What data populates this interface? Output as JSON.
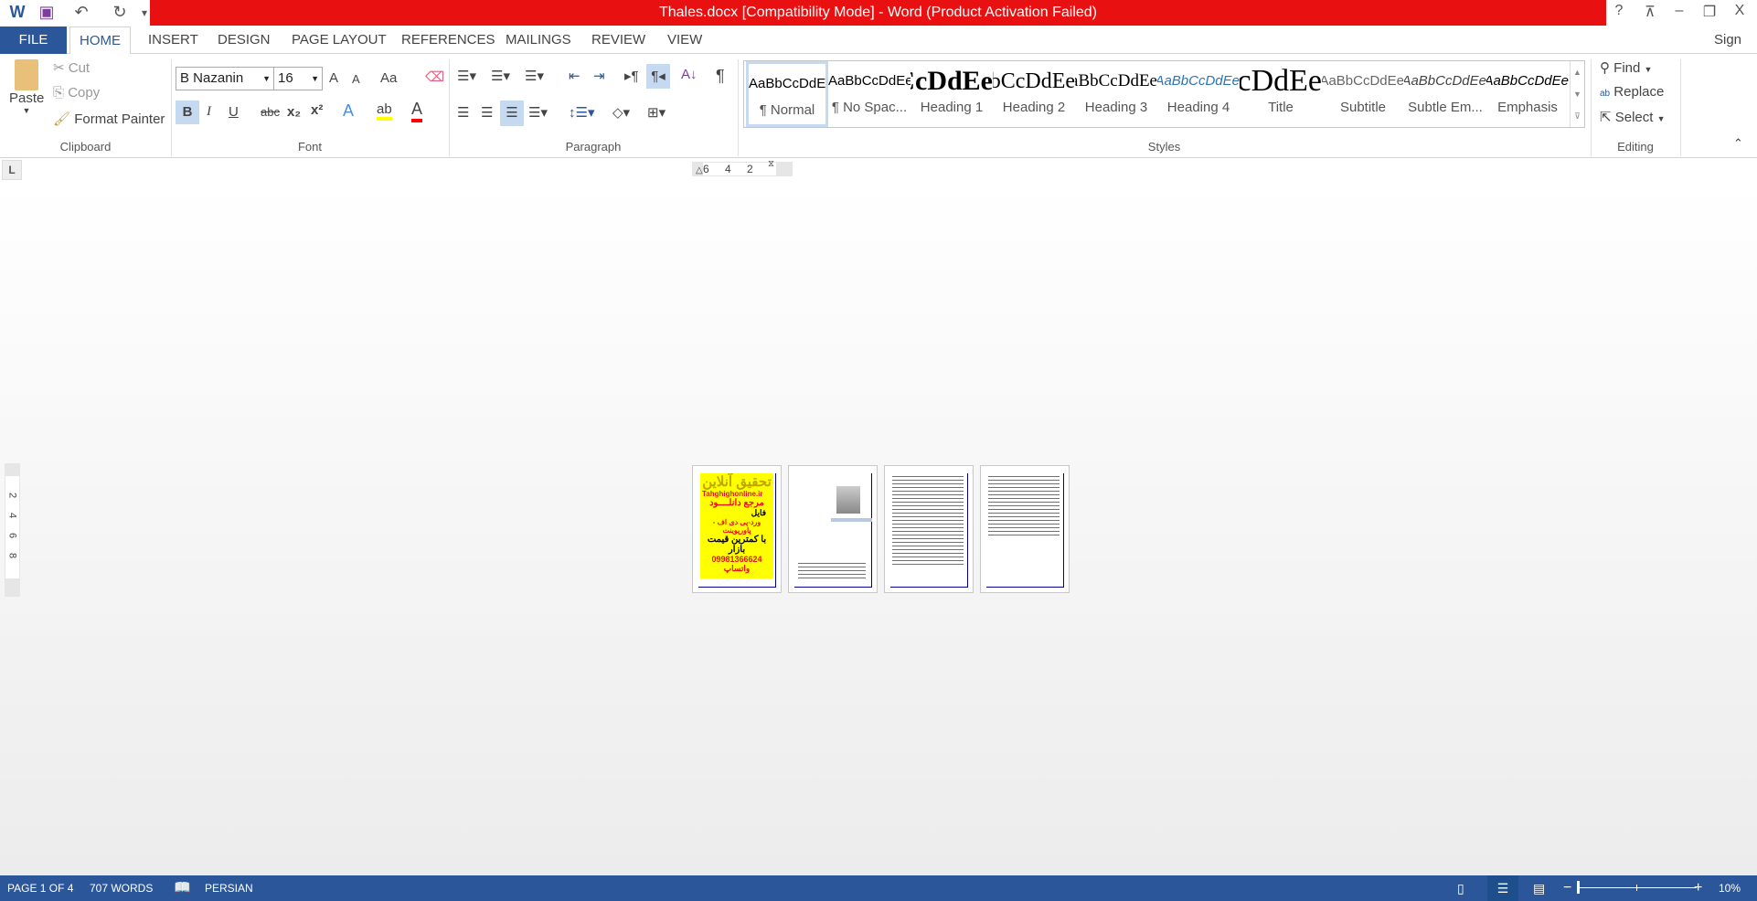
{
  "window": {
    "title": "Thales.docx [Compatibility Mode] -  Word (Product Activation Failed)",
    "help": "?",
    "restore_ribbon": "⊼",
    "minimize": "–",
    "restore": "❐",
    "close": "X",
    "sign_in": "Sign in",
    "accent": "#2b579a",
    "title_color": "#e81010"
  },
  "qat": {
    "save": "save-icon",
    "undo": "↶",
    "redo": "↻",
    "customize": "▾"
  },
  "tabs": [
    "FILE",
    "HOME",
    "INSERT",
    "DESIGN",
    "PAGE LAYOUT",
    "REFERENCES",
    "MAILINGS",
    "REVIEW",
    "VIEW"
  ],
  "clipboard": {
    "label": "Clipboard",
    "paste": "Paste",
    "cut": "Cut",
    "copy": "Copy",
    "format_painter": "Format Painter"
  },
  "font": {
    "label": "Font",
    "name": "B Nazanin",
    "size": "16",
    "grow": "A",
    "shrink": "A",
    "case": "Aa",
    "bold": "B",
    "italic": "I",
    "underline": "U",
    "strike": "abc",
    "sub": "x₂",
    "sup": "x²",
    "effects": "A",
    "highlight": "ab",
    "color": "A"
  },
  "paragraph": {
    "label": "Paragraph",
    "pilcrow": "¶",
    "sort": "A↓"
  },
  "styles": {
    "label": "Styles",
    "items": [
      {
        "preview": "AaBbCcDdEe",
        "name": "¶ Normal"
      },
      {
        "preview": "AaBbCcDdEe",
        "name": "¶ No Spac..."
      },
      {
        "preview": "AaBbCcDdEe",
        "name": "Heading 1"
      },
      {
        "preview": "AaBbCcDdEe",
        "name": "Heading 2"
      },
      {
        "preview": "AaBbCcDdEe",
        "name": "Heading 3"
      },
      {
        "preview": "AaBbCcDdEe",
        "name": "Heading 4"
      },
      {
        "preview": "AaBbCcDdEe",
        "name": "Title"
      },
      {
        "preview": "AaBbCcDdEe",
        "name": "Subtitle"
      },
      {
        "preview": "AaBbCcDdEe",
        "name": "Subtle Em..."
      },
      {
        "preview": "AaBbCcDdEe",
        "name": "Emphasis"
      }
    ]
  },
  "editing": {
    "label": "Editing",
    "find": "Find",
    "replace": "Replace",
    "select": "Select"
  },
  "ruler": {
    "tab_selector": "L",
    "ticks": [
      "6",
      "4",
      "2"
    ],
    "vticks": [
      "2",
      "4",
      "6",
      "8"
    ]
  },
  "pages": {
    "cover": {
      "title": "تحقیق آنلاین",
      "site": "Tahghighonline.ir",
      "line1": "مرجع دانلــــود",
      "line2": "فایل",
      "line3": "ورد-پی دی اف - پاورپوینت",
      "line4": "با کمترین قیمت بازار",
      "line5": "09981366624 واتساپ"
    }
  },
  "status": {
    "page": "PAGE 1 OF 4",
    "words": "707 WORDS",
    "language": "PERSIAN",
    "zoom": "10%",
    "zoom_level_percent": 10
  }
}
